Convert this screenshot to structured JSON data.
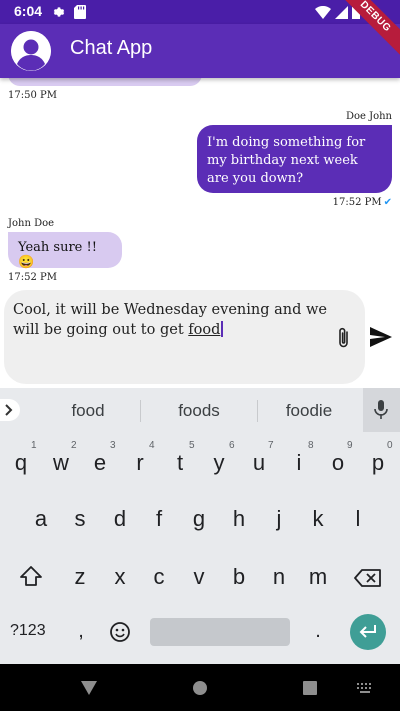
{
  "status_bar": {
    "time": "6:04",
    "left_icons": [
      "gear-icon",
      "sd-card-icon"
    ],
    "right_icons": [
      "wifi-icon",
      "signal-icon",
      "battery-icon"
    ],
    "debug_label": "DEBUG"
  },
  "app_bar": {
    "title": "Chat App",
    "avatar_icon": "account-circle-icon"
  },
  "chat": {
    "messages": [
      {
        "direction": "incoming",
        "sender": "",
        "text": "",
        "time": "17:50 PM"
      },
      {
        "direction": "outgoing",
        "sender": "Doe John",
        "text": "I'm doing something for my birthday next week are you down?",
        "time": "17:52 PM",
        "status_icon": "double-check-icon"
      },
      {
        "direction": "incoming",
        "sender": "John Doe",
        "text": "Yeah sure !!😀",
        "time": "17:52 PM"
      }
    ]
  },
  "composer": {
    "text_before": "Cool, it will be Wednesday evening and we will be going out to get ",
    "text_current_word": "food",
    "attach_icon": "paperclip-icon",
    "send_icon": "send-icon"
  },
  "keyboard": {
    "suggestions": [
      "food",
      "foods",
      "foodie"
    ],
    "row1": [
      "q",
      "w",
      "e",
      "r",
      "t",
      "y",
      "u",
      "i",
      "o",
      "p"
    ],
    "row1_numbers": [
      "1",
      "2",
      "3",
      "4",
      "5",
      "6",
      "7",
      "8",
      "9",
      "0"
    ],
    "row2": [
      "a",
      "s",
      "d",
      "f",
      "g",
      "h",
      "j",
      "k",
      "l"
    ],
    "row3": [
      "z",
      "x",
      "c",
      "v",
      "b",
      "n",
      "m"
    ],
    "symbols_key": "?123",
    "comma_key": ",",
    "period_key": ".",
    "accent": "#3f9e96"
  },
  "colors": {
    "primary": "#5b2db6",
    "status_bar": "#4a1ea8",
    "incoming_bubble": "#d8caf0",
    "input_bg": "#efefef"
  }
}
